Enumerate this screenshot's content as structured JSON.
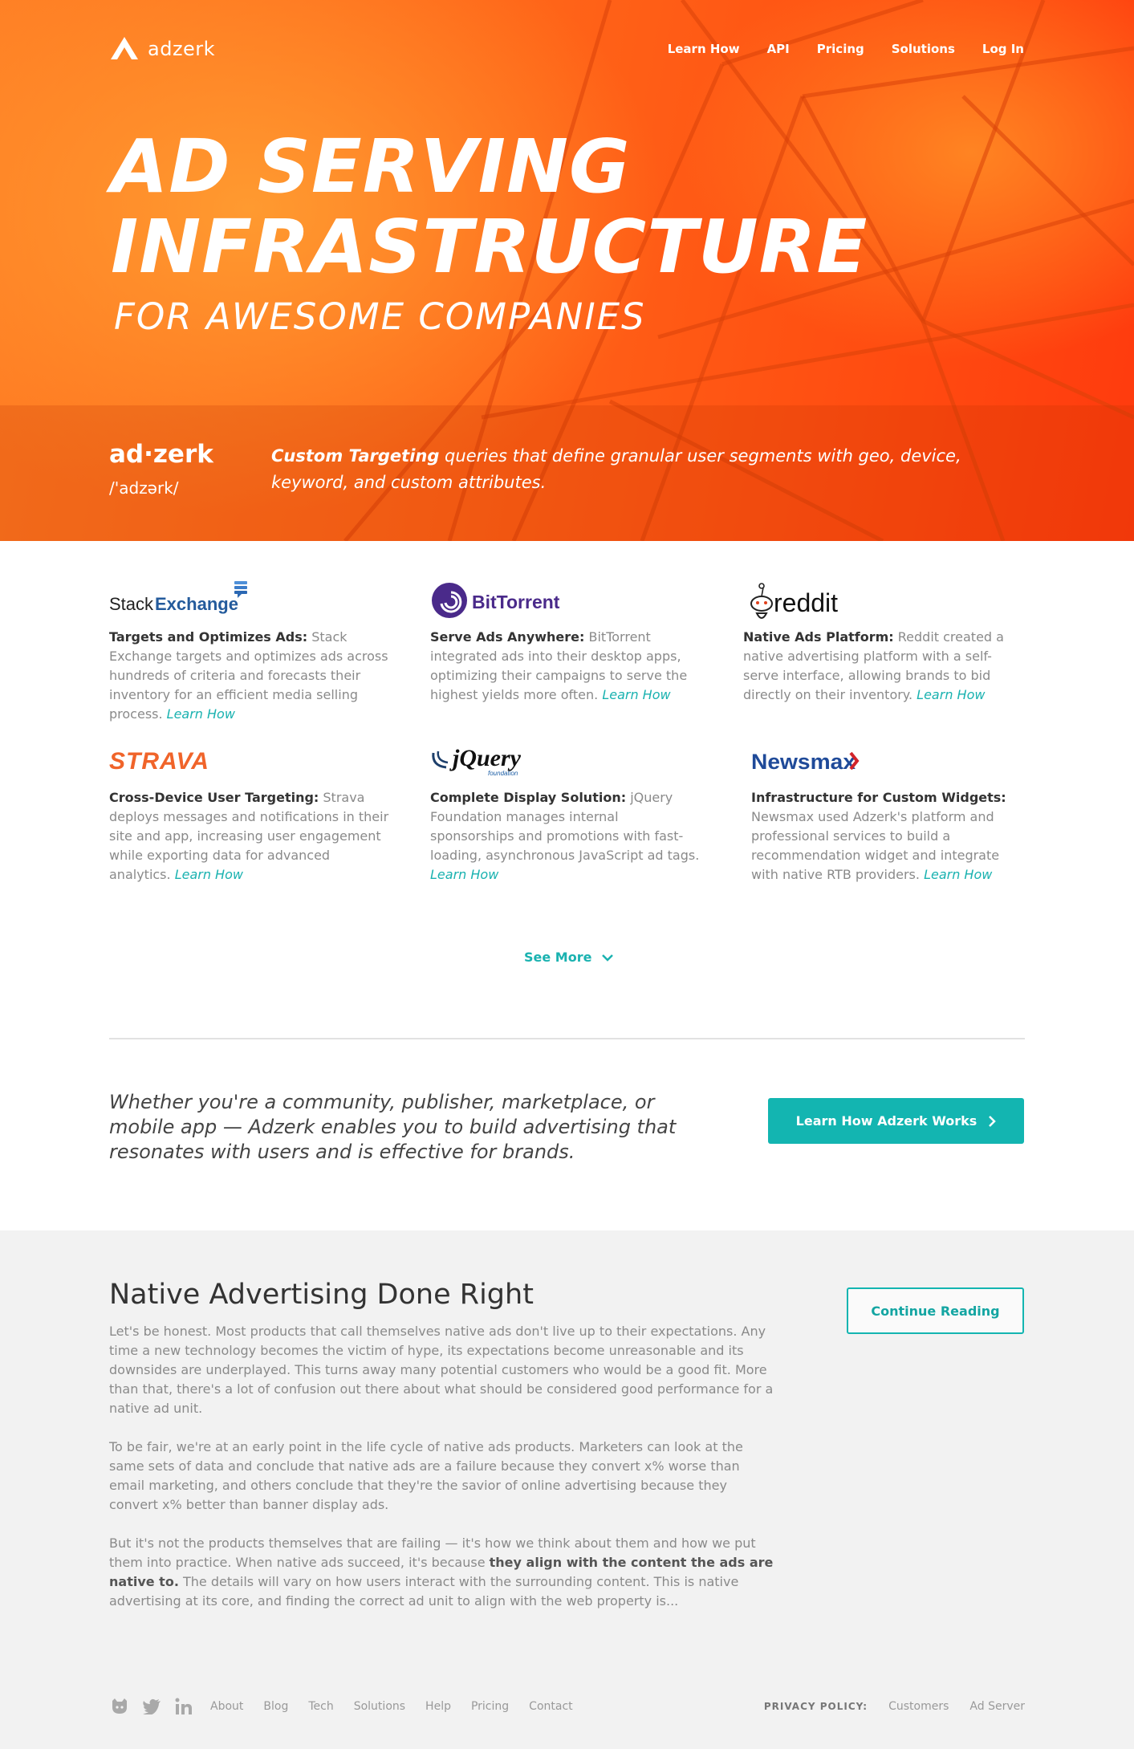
{
  "nav": {
    "logo_text": "adzerk",
    "items": [
      "Learn How",
      "API",
      "Pricing",
      "Solutions",
      "Log In"
    ]
  },
  "hero": {
    "line1": "AD SERVING",
    "line2": "INFRASTRUCTURE",
    "subtitle": "FOR AWESOME COMPANIES"
  },
  "definition": {
    "word": "ad·zerk",
    "pronunciation": "/'adzərk/",
    "tagline_bold": "Custom Targeting",
    "tagline_rest": " queries that define granular user segments with geo, device, keyword, and custom attributes."
  },
  "cases": [
    {
      "logo": "StackExchange",
      "title": "Targets and Optimizes Ads:",
      "text": " Stack Exchange targets and optimizes ads across hundreds of criteria and forecasts their inventory for an efficient media selling process. ",
      "link": "Learn How"
    },
    {
      "logo": "BitTorrent",
      "title": "Serve Ads Anywhere:",
      "text": " BitTorrent integrated ads into their desktop apps, optimizing their campaigns to serve the highest yields more often. ",
      "link": "Learn How"
    },
    {
      "logo": "reddit",
      "title": "Native Ads Platform:",
      "text": " Reddit created a native advertising platform with a self-serve interface, allowing brands to bid directly on their inventory. ",
      "link": "Learn How"
    },
    {
      "logo": "STRAVA",
      "title": "Cross-Device User Targeting:",
      "text": " Strava deploys messages and notifications in their site and app, increasing user engagement while exporting data for advanced analytics. ",
      "link": "Learn How"
    },
    {
      "logo": "jQuery",
      "logo_sub": "foundation",
      "title": "Complete Display Solution:",
      "text": " jQuery Foundation manages internal sponsorships and promotions with fast-loading, asynchronous JavaScript ad tags. ",
      "link": "Learn How"
    },
    {
      "logo": "Newsmax",
      "title": "Infrastructure for Custom Widgets:",
      "text": " Newsmax used Adzerk's platform and professional services to build a recommendation widget and integrate with native RTB providers. ",
      "link": "Learn How"
    }
  ],
  "see_more": "See More",
  "pitch": {
    "text": "Whether you're a community, publisher, marketplace, or mobile app — Adzerk enables you to build advertising that resonates with users and is effective for brands.",
    "button": "Learn How Adzerk Works"
  },
  "blog": {
    "title": "Native Advertising Done Right",
    "p1": "Let's be honest. Most products that call themselves native ads don't live up to their expectations. Any time a new technology becomes the victim of hype, its expectations become unreasonable and its downsides are underplayed. This turns away many potential customers who would be a good fit. More than that, there's a lot of confusion out there about what should be considered good performance for a native ad unit.",
    "p2": "To be fair, we're at an early point in the life cycle of native ads products. Marketers can look at the same sets of data and conclude that native ads are a failure because they convert x% worse than email marketing, and others conclude that they're the savior of online advertising because they convert x% better than banner display ads.",
    "p3_a": "But it's not the products themselves that are failing — it's how we think about them and how we put them into practice. When native ads succeed, it's because ",
    "p3_bold": "they align with the content the ads are native to.",
    "p3_b": " The details will vary on how users interact with the surrounding content. This is native advertising at its core, and finding the correct ad unit to align with the web property is...",
    "button": "Continue Reading"
  },
  "footer": {
    "icons": [
      "github-icon",
      "twitter-icon",
      "linkedin-icon"
    ],
    "links": [
      "About",
      "Blog",
      "Tech",
      "Solutions",
      "Help",
      "Pricing",
      "Contact"
    ],
    "privacy_label": "PRIVACY POLICY:",
    "privacy_links": [
      "Customers",
      "Ad Server"
    ]
  },
  "colors": {
    "accent": "#13b5b1",
    "hero_orange": "#ff6418"
  }
}
